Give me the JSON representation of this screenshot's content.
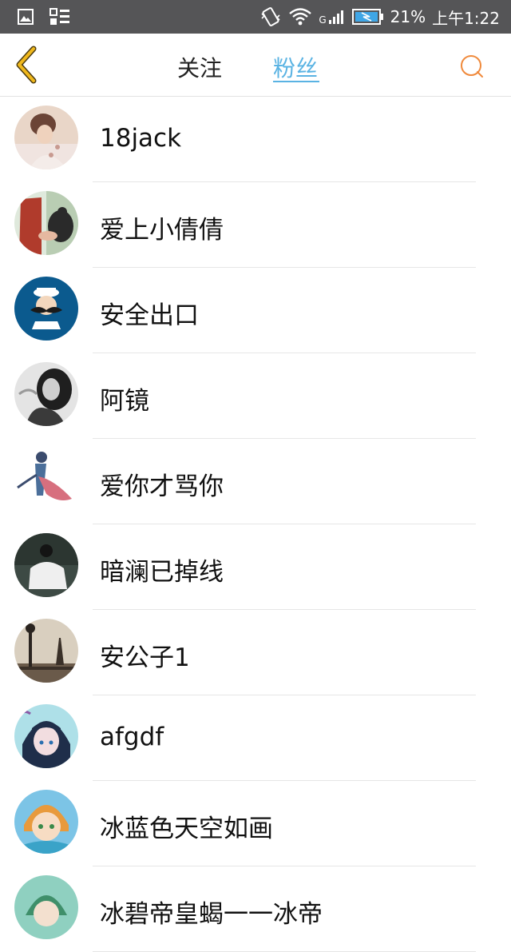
{
  "status_bar": {
    "network_type": "G",
    "battery_percent": "21%",
    "time": "上午1:22",
    "icons": [
      "gallery-icon",
      "widget-icon",
      "vibrate-icon",
      "wifi-icon",
      "signal-icon",
      "battery-icon"
    ]
  },
  "header": {
    "back_icon": "chevron-left-icon",
    "tabs": [
      {
        "label": "关注",
        "active": false
      },
      {
        "label": "粉丝",
        "active": true
      }
    ],
    "search_icon": "search-icon",
    "accent_color": "#5ab3e3",
    "back_color": "#f0b81c",
    "search_color": "#f08a3c"
  },
  "followers": [
    {
      "name": "18jack"
    },
    {
      "name": "爱上小倩倩"
    },
    {
      "name": "安全出口"
    },
    {
      "name": "阿镜"
    },
    {
      "name": "爱你才骂你"
    },
    {
      "name": "暗澜已掉线"
    },
    {
      "name": "安公子1"
    },
    {
      "name": "afgdf"
    },
    {
      "name": "冰蓝色天空如画"
    },
    {
      "name": "冰碧帝皇蝎一一冰帝"
    }
  ]
}
